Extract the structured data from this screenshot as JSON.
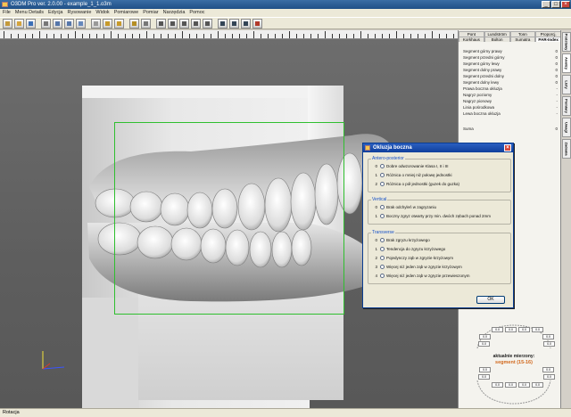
{
  "window": {
    "title": "O3DM Pro ver. 2.0.00 - example_1_1.o3m"
  },
  "menu": [
    "File",
    "Menu Details",
    "Edycja",
    "Rysowanie",
    "Widok",
    "Pomiarowe",
    "Pomiar",
    "Narzędzia",
    "Pomoc"
  ],
  "panel": {
    "tabs_row1": [
      "Pont",
      "Lundström",
      "Tonn",
      "Proporcj."
    ],
    "tabs_row2": [
      "Korkhaus",
      "Bolton",
      "Sumatra",
      "PAR-Index"
    ],
    "active_tab": "PAR-Index",
    "rows": [
      {
        "label": "Segment górny prawy",
        "value": "0"
      },
      {
        "label": "Segment przedni górny",
        "value": "0"
      },
      {
        "label": "Segment górny lewy",
        "value": "0"
      },
      {
        "label": "Segment dolny prawy",
        "value": "0"
      },
      {
        "label": "Segment przedni dolny",
        "value": "0"
      },
      {
        "label": "Segment dolny lewy",
        "value": "0"
      },
      {
        "label": "Prawa boczna okluzja",
        "value": "-"
      },
      {
        "label": "Nagryz poziomy",
        "value": "-"
      },
      {
        "label": "Nagryz pionowy",
        "value": "-"
      },
      {
        "label": "Linia pośrodkowa",
        "value": "-"
      },
      {
        "label": "Lewa boczna okluzja",
        "value": "-"
      }
    ],
    "sum_label": "Suma",
    "sum_value": "0"
  },
  "side_tabs": [
    "Podstawy",
    "Analizy",
    "Listy",
    "Pomiary",
    "Uwagi",
    "Zadania"
  ],
  "measured": {
    "label": "aktualnie mierzony:",
    "segment": "segment (15-16)",
    "cell_value": "0.0"
  },
  "dialog": {
    "title": "Okluzja boczna",
    "ok_label": "OK",
    "groups": [
      {
        "title": "Antero-posterior",
        "options": [
          {
            "n": "0",
            "label": "Dobre odwzorowanie Klasa I, II i III"
          },
          {
            "n": "1",
            "label": "Różnica o mniej niż połowę jednostki"
          },
          {
            "n": "2",
            "label": "Różnica o pół jednostki (guzek do guzka)"
          }
        ]
      },
      {
        "title": "Vertical",
        "options": [
          {
            "n": "0",
            "label": "Brak odchyleń w zagryzaniu"
          },
          {
            "n": "1",
            "label": "Boczny zgryz otwarty przy min. dwóch zębach ponad 2mm"
          }
        ]
      },
      {
        "title": "Transverse",
        "options": [
          {
            "n": "0",
            "label": "Brak zgryzu krzyżowego"
          },
          {
            "n": "1",
            "label": "Tendencja do zgryzu krzyżowego"
          },
          {
            "n": "2",
            "label": "Pojedynczy ząb w zgryzie krzyżowym"
          },
          {
            "n": "3",
            "label": "Więcej niż jeden ząb w zgryzie krzyżowym"
          },
          {
            "n": "4",
            "label": "Więcej niż jeden ząb w zgryzie przewieszonym"
          }
        ]
      }
    ]
  },
  "status": {
    "text": "Rotacja"
  },
  "colors": {
    "titlebar": "#1f4f86",
    "selection_box": "#2fbf2f",
    "accent_segment": "#d2691e"
  }
}
